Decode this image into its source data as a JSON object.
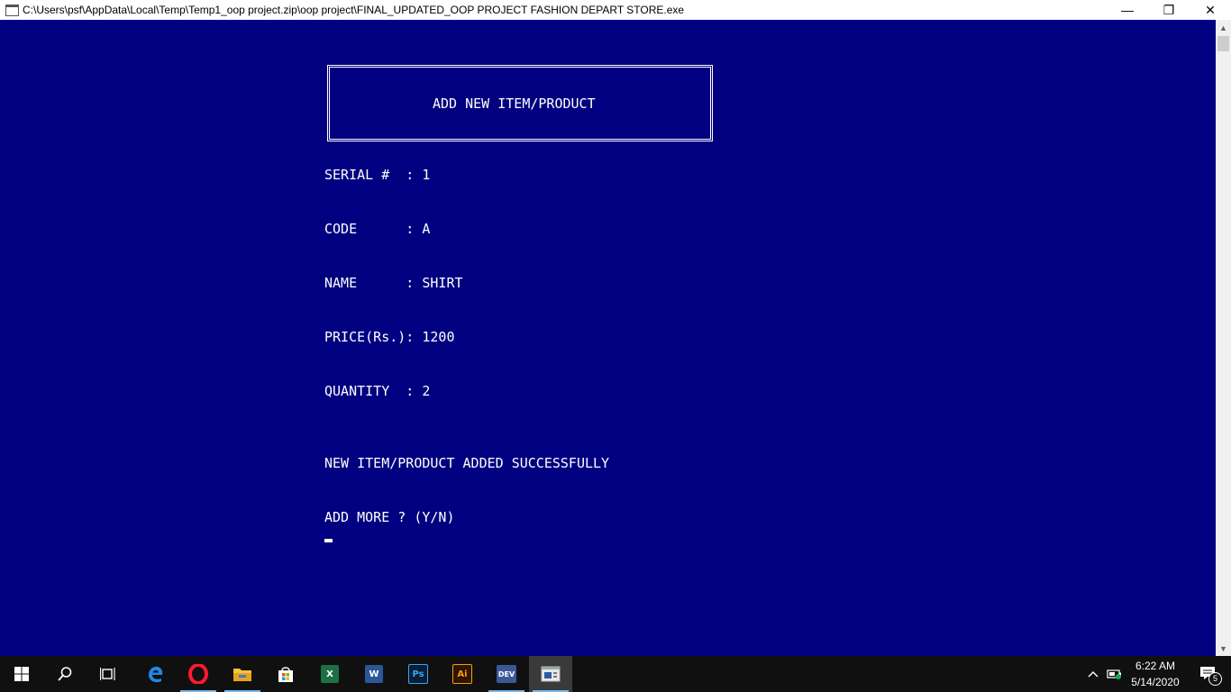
{
  "window": {
    "title": "C:\\Users\\psf\\AppData\\Local\\Temp\\Temp1_oop project.zip\\oop project\\FINAL_UPDATED_OOP PROJECT FASHION DEPART STORE.exe",
    "minimize_glyph": "—",
    "maximize_glyph": "❐",
    "close_glyph": "✕"
  },
  "console": {
    "header": "ADD NEW ITEM/PRODUCT",
    "fields": [
      {
        "text": "SERIAL #  : 1"
      },
      {
        "text": "CODE      : A"
      },
      {
        "text": "NAME      : SHIRT"
      },
      {
        "text": "PRICE(Rs.): 1200"
      },
      {
        "text": "QUANTITY  : 2"
      }
    ],
    "success_message": "NEW ITEM/PRODUCT ADDED SUCCESSFULLY",
    "prompt": "ADD MORE ? (Y/N)"
  },
  "scrollbar": {
    "up_arrow": "▲",
    "down_arrow": "▼"
  },
  "taskbar": {
    "apps": [
      {
        "name": "excel",
        "label": "X",
        "color": "#1d7044"
      },
      {
        "name": "word",
        "label": "W",
        "color": "#2b579a"
      },
      {
        "name": "photoshop",
        "label": "Ps",
        "color": "#0a1e33",
        "text_color": "#31a8ff"
      },
      {
        "name": "illustrator",
        "label": "Ai",
        "color": "#2a1600",
        "text_color": "#ff9a00"
      },
      {
        "name": "devcpp",
        "label": "DEV",
        "color": "#3b5998"
      }
    ],
    "clock": {
      "time": "6:22 AM",
      "date": "5/14/2020"
    },
    "notification_count": "5"
  }
}
